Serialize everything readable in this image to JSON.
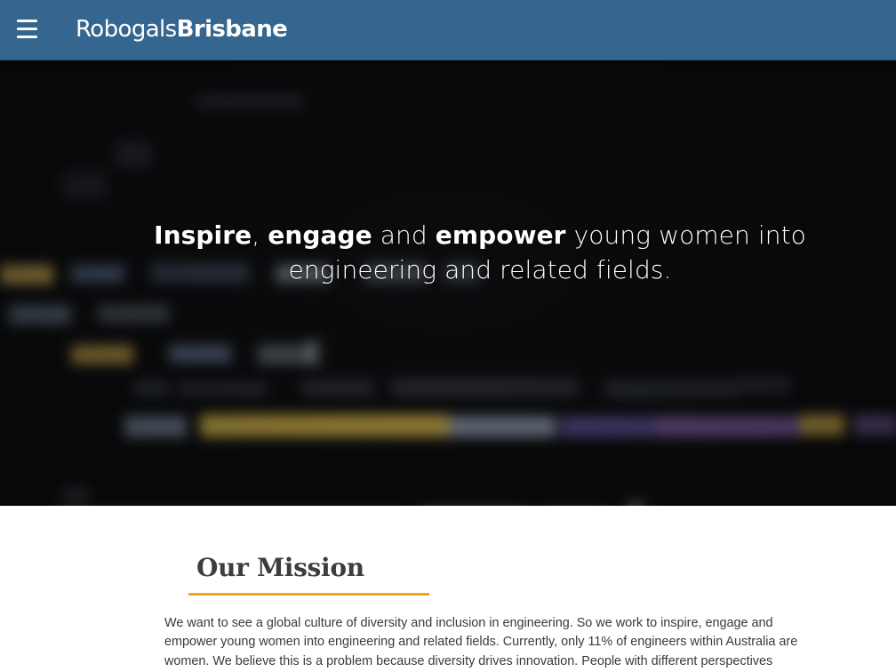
{
  "header": {
    "menu_icon": "hamburger-menu-icon",
    "brand_light": "Robogals",
    "brand_bold": "Brisbane",
    "background_color": "#35668f"
  },
  "hero": {
    "segments": [
      {
        "text": "Inspire",
        "bold": true
      },
      {
        "text": ", ",
        "bold": false
      },
      {
        "text": "engage",
        "bold": true
      },
      {
        "text": " and ",
        "bold": false
      },
      {
        "text": "empower",
        "bold": true
      },
      {
        "text": " young women into engineering and related fields.",
        "bold": false
      }
    ],
    "background_description_icon": "blurred-code-background"
  },
  "mission": {
    "title": "Our Mission",
    "accent_color": "#f0a31e",
    "body": "We want to see a global culture of diversity and inclusion in engineering. So we work to inspire, engage and empower young women into engineering and related fields. Currently, only 11% of engineers within Australia are women. We believe this is a problem because diversity drives innovation. People with different perspectives"
  }
}
